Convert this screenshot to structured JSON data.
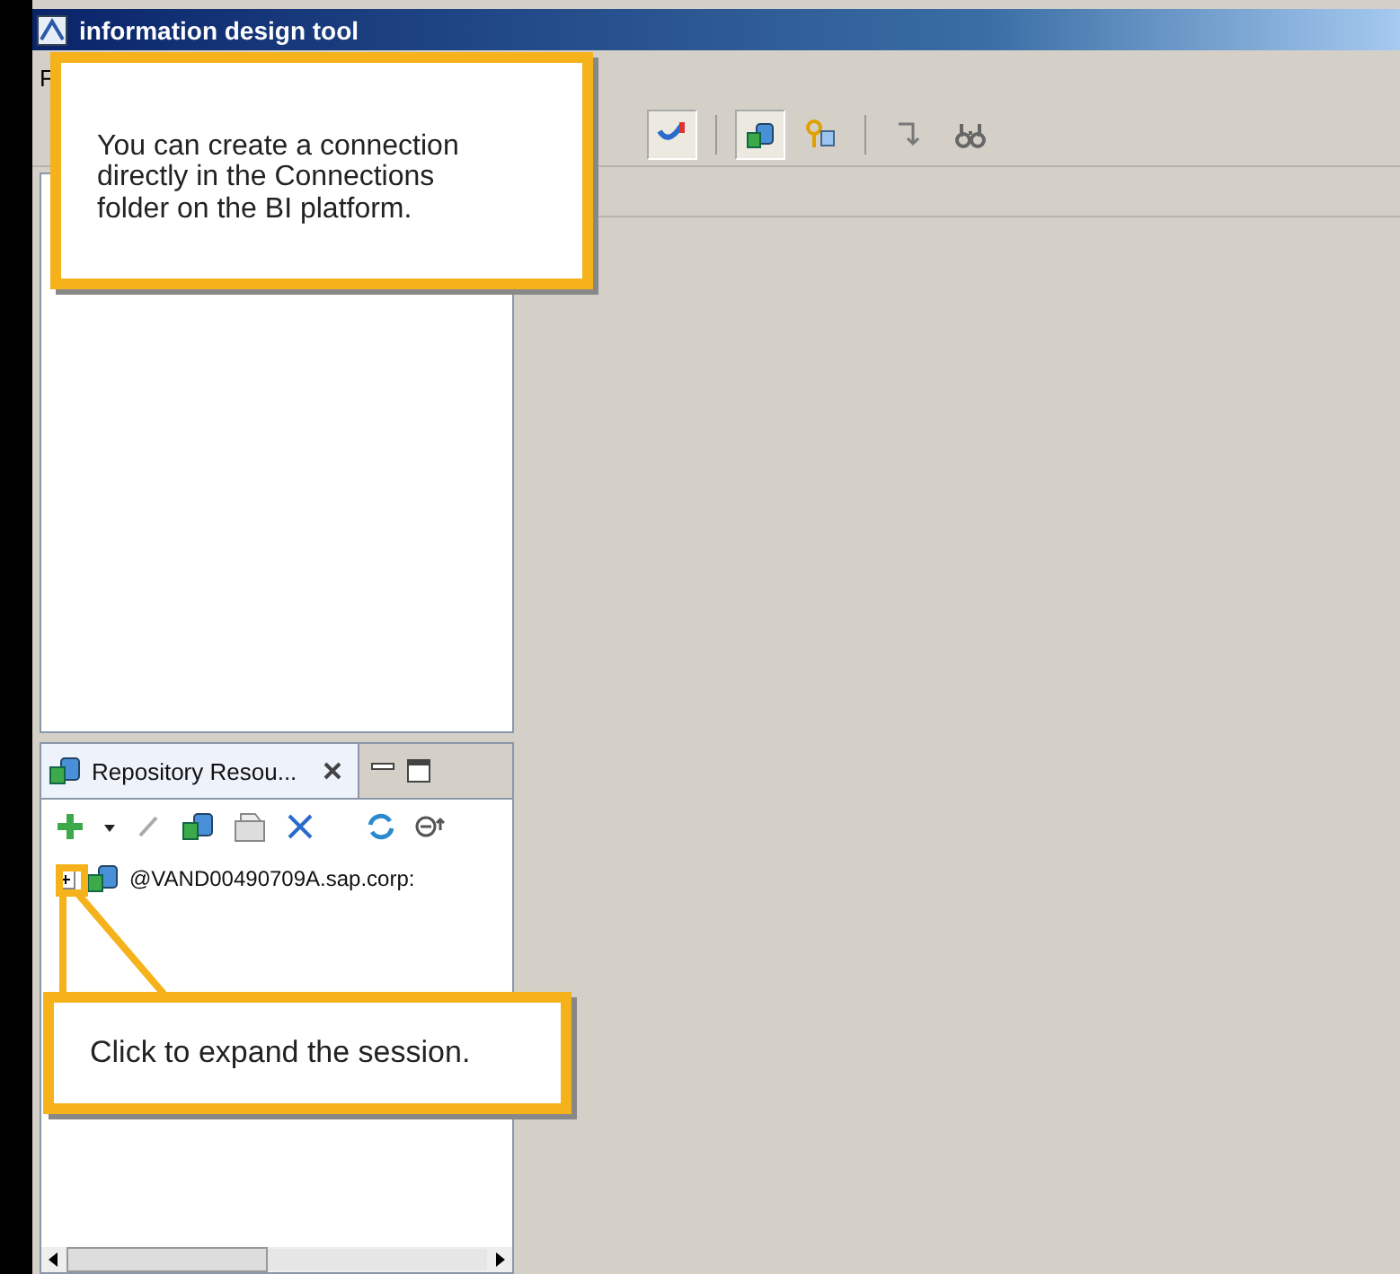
{
  "window": {
    "title": "information design tool"
  },
  "menu": [
    "F"
  ],
  "toolbar": [
    {
      "kind": "schema",
      "selected": true
    },
    {
      "kind": "database",
      "selected": true
    },
    {
      "kind": "key",
      "selected": false
    },
    {
      "kind": "arrow",
      "selected": false
    },
    {
      "kind": "binoculars",
      "selected": false
    }
  ],
  "repository_panel": {
    "title": "Repository Resou...",
    "tree": [
      {
        "label": "@VAND00490709A.sap.corp:",
        "expanded": false
      }
    ]
  },
  "callouts": [
    {
      "text": "You can create a connection directly in the Connections folder on the BI platform."
    },
    {
      "text": "Click to expand the session."
    }
  ]
}
